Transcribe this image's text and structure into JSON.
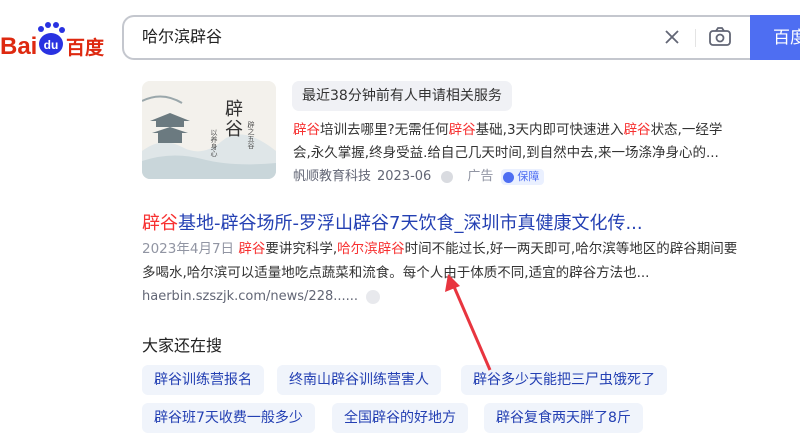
{
  "logo": {
    "text": "Bai",
    "paw": "du",
    "cn": "百度"
  },
  "search": {
    "query": "哈尔滨辟谷",
    "button_label": "百度"
  },
  "ad": {
    "thumb_text_main": "辟谷",
    "thumb_text_side1": "辟之五谷",
    "thumb_text_side2": "以养身心",
    "tag": "最近38分钟前有人申请相关服务",
    "desc_hl1": "辟谷",
    "desc_part1": "培训去哪里?无需任何",
    "desc_hl2": "辟谷",
    "desc_part2": "基础,3天内即可快速进入",
    "desc_hl3": "辟谷",
    "desc_part3": "状态,一经学会,永久掌握,终身受益.给自己几天时间,到自然中去,来一场涤净身心的...",
    "source": "帆顺教育科技",
    "date": "2023-06",
    "ad_label": "广告",
    "badge": "保障"
  },
  "result": {
    "title_hl": "辟谷",
    "title_rest": "基地-辟谷场所-罗浮山辟谷7天饮食_深圳市真健康文化传...",
    "date": "2023年4月7日",
    "body_hl1": "辟谷",
    "body_part1": "要讲究科学,",
    "body_hl2": "哈尔滨辟谷",
    "body_part2": "时间不能过长,好一两天即可,哈尔滨等地区的辟谷期间要多喝水,哈尔滨可以适量地吃点蔬菜和流食。每个人由于体质不同,适宜的辟谷方法也...",
    "url": "haerbin.szszjk.com/news/228......"
  },
  "related": {
    "title": "大家还在搜",
    "items": [
      "辟谷训练营报名",
      "终南山辟谷训练营害人",
      "辟谷多少天能把三尸虫饿死了",
      "辟谷班7天收费一般多少",
      "全国辟谷的好地方",
      "辟谷复食两天胖了8斤"
    ]
  },
  "colors": {
    "accent": "#4e6ef2",
    "link": "#2440b3",
    "highlight": "#f73131",
    "arrow": "#e8353f"
  }
}
